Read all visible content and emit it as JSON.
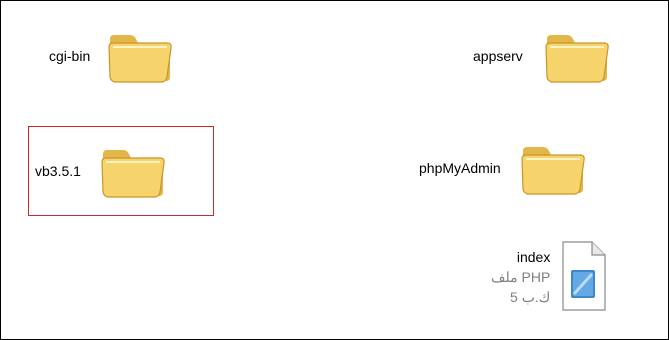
{
  "items": [
    {
      "name": "cgi-bin",
      "type": "folder"
    },
    {
      "name": "appserv",
      "type": "folder"
    },
    {
      "name": "vb3.5.1",
      "type": "folder",
      "selected": true
    },
    {
      "name": "phpMyAdmin",
      "type": "folder"
    },
    {
      "name": "index",
      "type": "file",
      "type_label": "ملف PHP",
      "size": "ك.ب 5"
    }
  ],
  "colors": {
    "selection_border": "#cc2a2a",
    "folder_fill": "#f6d36b",
    "folder_shadow": "#d9a52f"
  }
}
